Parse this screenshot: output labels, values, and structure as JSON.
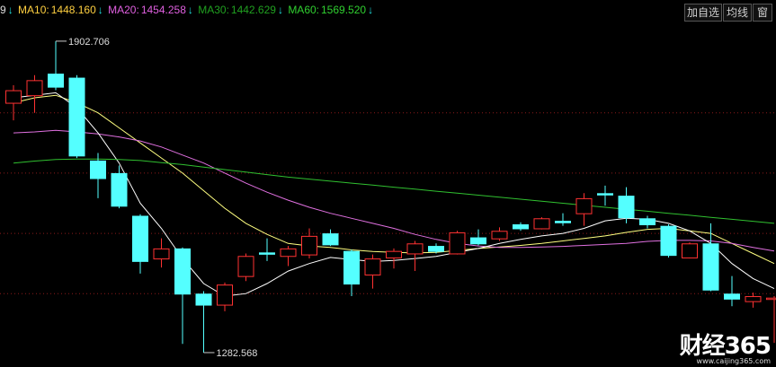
{
  "legend": {
    "prefix": "9",
    "items": [
      {
        "label": "MA10:",
        "value": "1448.160",
        "color": "#ffd040"
      },
      {
        "label": "MA20:",
        "value": "1454.258",
        "color": "#e060e0"
      },
      {
        "label": "MA30:",
        "value": "1442.629",
        "color": "#20a020"
      },
      {
        "label": "MA60:",
        "value": "1569.520",
        "color": "#30d030"
      }
    ],
    "arrow": "↓",
    "arrow_color": "#20e0e0"
  },
  "toolbar": {
    "add_watch": "加自选",
    "avg_line": "均线",
    "window": "窗"
  },
  "watermark": {
    "logo": "财经365",
    "url": "www.caijing365.com"
  },
  "chart_data": {
    "type": "candlestick",
    "annotations": [
      {
        "text": "1902.706",
        "value": 1902.706
      },
      {
        "text": "1282.568",
        "value": 1282.568
      }
    ],
    "ylim": [
      1270,
      1940
    ],
    "ref_lines": [
      1760,
      1640,
      1520,
      1400
    ],
    "candles": [
      {
        "o": 1780,
        "c": 1805,
        "h": 1815,
        "l": 1745
      },
      {
        "o": 1795,
        "c": 1825,
        "h": 1835,
        "l": 1760
      },
      {
        "o": 1838,
        "c": 1812,
        "h": 1902.706,
        "l": 1805
      },
      {
        "o": 1830,
        "c": 1675,
        "h": 1835,
        "l": 1670
      },
      {
        "o": 1665,
        "c": 1630,
        "h": 1680,
        "l": 1590
      },
      {
        "o": 1640,
        "c": 1575,
        "h": 1655,
        "l": 1570
      },
      {
        "o": 1555,
        "c": 1465,
        "h": 1558,
        "l": 1440
      },
      {
        "o": 1470,
        "c": 1490,
        "h": 1510,
        "l": 1452
      },
      {
        "o": 1490,
        "c": 1400,
        "h": 1492,
        "l": 1300
      },
      {
        "o": 1400,
        "c": 1378,
        "h": 1405,
        "l": 1282.568
      },
      {
        "o": 1378,
        "c": 1418,
        "h": 1422,
        "l": 1365
      },
      {
        "o": 1435,
        "c": 1475,
        "h": 1480,
        "l": 1425
      },
      {
        "o": 1482,
        "c": 1480,
        "h": 1510,
        "l": 1465
      },
      {
        "o": 1475,
        "c": 1490,
        "h": 1495,
        "l": 1455
      },
      {
        "o": 1478,
        "c": 1515,
        "h": 1530,
        "l": 1470
      },
      {
        "o": 1520,
        "c": 1498,
        "h": 1528,
        "l": 1495
      },
      {
        "o": 1485,
        "c": 1420,
        "h": 1488,
        "l": 1395
      },
      {
        "o": 1438,
        "c": 1470,
        "h": 1478,
        "l": 1410
      },
      {
        "o": 1472,
        "c": 1485,
        "h": 1490,
        "l": 1450
      },
      {
        "o": 1480,
        "c": 1500,
        "h": 1505,
        "l": 1445
      },
      {
        "o": 1495,
        "c": 1485,
        "h": 1500,
        "l": 1480
      },
      {
        "o": 1480,
        "c": 1522,
        "h": 1525,
        "l": 1478
      },
      {
        "o": 1512,
        "c": 1500,
        "h": 1528,
        "l": 1496
      },
      {
        "o": 1510,
        "c": 1525,
        "h": 1532,
        "l": 1505
      },
      {
        "o": 1538,
        "c": 1530,
        "h": 1542,
        "l": 1525
      },
      {
        "o": 1530,
        "c": 1550,
        "h": 1552,
        "l": 1528
      },
      {
        "o": 1545,
        "c": 1542,
        "h": 1560,
        "l": 1535
      },
      {
        "o": 1560,
        "c": 1590,
        "h": 1600,
        "l": 1535
      },
      {
        "o": 1600,
        "c": 1598,
        "h": 1615,
        "l": 1575
      },
      {
        "o": 1595,
        "c": 1552,
        "h": 1612,
        "l": 1540
      },
      {
        "o": 1550,
        "c": 1538,
        "h": 1555,
        "l": 1530
      },
      {
        "o": 1535,
        "c": 1477,
        "h": 1538,
        "l": 1472
      },
      {
        "o": 1472,
        "c": 1500,
        "h": 1502,
        "l": 1470
      },
      {
        "o": 1500,
        "c": 1408,
        "h": 1540,
        "l": 1405
      },
      {
        "o": 1400,
        "c": 1390,
        "h": 1435,
        "l": 1375
      },
      {
        "o": 1385,
        "c": 1395,
        "h": 1402,
        "l": 1372
      },
      {
        "o": 1390,
        "c": 1392,
        "h": 1395,
        "l": 1302
      }
    ],
    "series": [
      {
        "name": "MA10",
        "color": "#ffff80",
        "values": [
          1780,
          1790,
          1795,
          1780,
          1760,
          1730,
          1700,
          1670,
          1640,
          1605,
          1570,
          1540,
          1518,
          1500,
          1495,
          1492,
          1487,
          1484,
          1482,
          1481,
          1482,
          1486,
          1490,
          1493,
          1496,
          1500,
          1505,
          1510,
          1515,
          1522,
          1528,
          1530,
          1525,
          1520,
          1500,
          1480,
          1460
        ]
      },
      {
        "name": "MA20",
        "color": "#e070e0",
        "values": [
          1720,
          1722,
          1725,
          1722,
          1718,
          1712,
          1704,
          1692,
          1676,
          1660,
          1640,
          1620,
          1602,
          1586,
          1572,
          1560,
          1550,
          1540,
          1530,
          1518,
          1508,
          1500,
          1495,
          1492,
          1492,
          1493,
          1494,
          1496,
          1498,
          1500,
          1504,
          1506,
          1506,
          1505,
          1500,
          1492,
          1485
        ]
      },
      {
        "name": "MA30",
        "color": "#ffffff",
        "values": [
          1790,
          1795,
          1800,
          1770,
          1720,
          1660,
          1580,
          1530,
          1470,
          1420,
          1395,
          1400,
          1420,
          1445,
          1460,
          1472,
          1468,
          1464,
          1466,
          1470,
          1474,
          1482,
          1490,
          1500,
          1508,
          1515,
          1520,
          1530,
          1545,
          1550,
          1548,
          1540,
          1525,
          1500,
          1460,
          1430,
          1410
        ]
      },
      {
        "name": "MA60",
        "color": "#30c030",
        "values": [
          1660,
          1664,
          1667,
          1668,
          1668,
          1667,
          1665,
          1661,
          1657,
          1652,
          1647,
          1642,
          1637,
          1632,
          1628,
          1624,
          1620,
          1616,
          1612,
          1608,
          1604,
          1600,
          1596,
          1592,
          1588,
          1584,
          1580,
          1576,
          1572,
          1568,
          1564,
          1560,
          1556,
          1552,
          1548,
          1544,
          1540
        ]
      }
    ]
  }
}
